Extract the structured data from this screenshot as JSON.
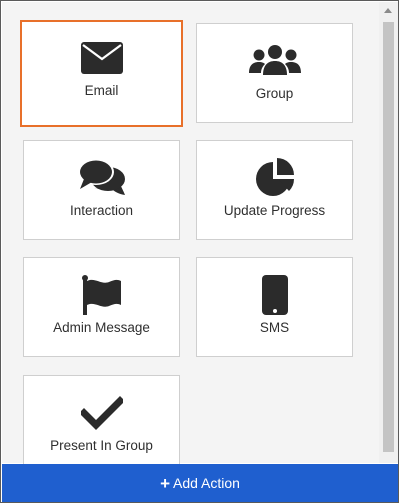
{
  "actions": [
    {
      "label": "Email",
      "icon": "envelope-icon",
      "selected": true
    },
    {
      "label": "Group",
      "icon": "users-icon",
      "selected": false
    },
    {
      "label": "Interaction",
      "icon": "comments-icon",
      "selected": false
    },
    {
      "label": "Update Progress",
      "icon": "pie-chart-icon",
      "selected": false
    },
    {
      "label": "Admin Message",
      "icon": "flag-icon",
      "selected": false
    },
    {
      "label": "SMS",
      "icon": "mobile-phone-icon",
      "selected": false
    },
    {
      "label": "Present In Group",
      "icon": "checkmark-icon",
      "selected": false
    }
  ],
  "add_action": {
    "icon": "plus-icon",
    "label": "Add Action"
  },
  "colors": {
    "selected_border": "#e8702a",
    "add_bar": "#1f5fcf",
    "icon": "#2b2b2b"
  }
}
